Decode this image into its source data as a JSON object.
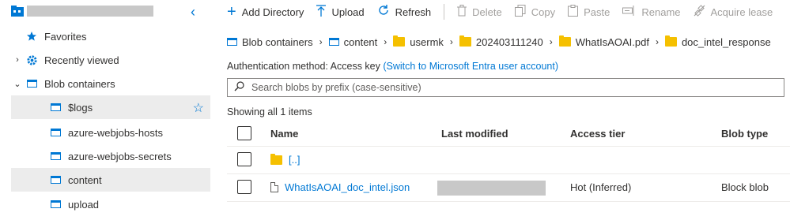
{
  "sidebar": {
    "items": [
      {
        "label": "Favorites"
      },
      {
        "label": "Recently viewed"
      },
      {
        "label": "Blob containers"
      },
      {
        "label": "$logs"
      },
      {
        "label": "azure-webjobs-hosts"
      },
      {
        "label": "azure-webjobs-secrets"
      },
      {
        "label": "content"
      },
      {
        "label": "upload"
      }
    ]
  },
  "toolbar": {
    "add_directory": "Add Directory",
    "upload": "Upload",
    "refresh": "Refresh",
    "delete": "Delete",
    "copy": "Copy",
    "paste": "Paste",
    "rename": "Rename",
    "acquire_lease": "Acquire lease"
  },
  "breadcrumb": [
    "Blob containers",
    "content",
    "usermk",
    "202403111240",
    "WhatIsAOAI.pdf",
    "doc_intel_response"
  ],
  "auth": {
    "label": "Authentication method:",
    "value": "Access key",
    "link": "(Switch to Microsoft Entra user account)"
  },
  "search": {
    "placeholder": "Search blobs by prefix (case-sensitive)"
  },
  "showing": "Showing all 1 items",
  "table": {
    "headers": {
      "name": "Name",
      "modified": "Last modified",
      "tier": "Access tier",
      "type": "Blob type"
    },
    "rows": [
      {
        "name": "[..]",
        "tier": "",
        "type": ""
      },
      {
        "name": "WhatIsAOAI_doc_intel.json",
        "tier": "Hot (Inferred)",
        "type": "Block blob"
      }
    ]
  },
  "colors": {
    "accent": "#0078d4",
    "folder": "#f5c000",
    "selected_bg": "#ececec"
  }
}
